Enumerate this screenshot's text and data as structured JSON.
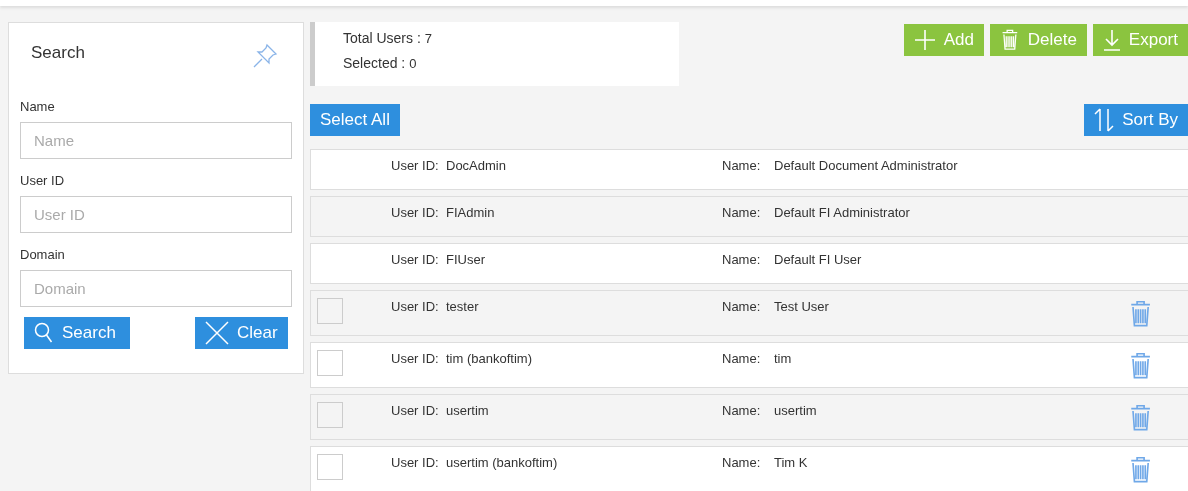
{
  "search_panel": {
    "title": "Search",
    "fields": [
      {
        "label": "Name",
        "placeholder": "Name"
      },
      {
        "label": "User ID",
        "placeholder": "User ID"
      },
      {
        "label": "Domain",
        "placeholder": "Domain"
      }
    ],
    "search_button": "Search",
    "clear_button": "Clear"
  },
  "summary": {
    "total_label": "Total Users :",
    "total": "7",
    "selected_label": "Selected :",
    "selected": "0"
  },
  "actions": [
    "Add",
    "Delete",
    "Export"
  ],
  "select_all": "Select All",
  "sort_by": "Sort By",
  "users": [
    {
      "user_id_label": "User ID:",
      "user_id": "DocAdmin",
      "name_label": "Name:",
      "name": "Default Document Administrator",
      "deletable": false,
      "selected": false
    },
    {
      "user_id_label": "User ID:",
      "user_id": "FIAdmin",
      "name_label": "Name:",
      "name": "Default FI Administrator",
      "deletable": false,
      "selected": false
    },
    {
      "user_id_label": "User ID:",
      "user_id": "FIUser",
      "name_label": "Name:",
      "name": "Default FI User",
      "deletable": false,
      "selected": false
    },
    {
      "user_id_label": "User ID:",
      "user_id": "tester",
      "name_label": "Name:",
      "name": "Test User",
      "deletable": true,
      "selected": false
    },
    {
      "user_id_label": "User ID:",
      "user_id": "tim (bankoftim)",
      "name_label": "Name:",
      "name": "tim",
      "deletable": true,
      "selected": false
    },
    {
      "user_id_label": "User ID:",
      "user_id": "usertim",
      "name_label": "Name:",
      "name": "usertim",
      "deletable": true,
      "selected": false
    },
    {
      "user_id_label": "User ID:",
      "user_id": "usertim (bankoftim)",
      "name_label": "Name:",
      "name": "Tim K",
      "deletable": true,
      "selected": false
    }
  ]
}
